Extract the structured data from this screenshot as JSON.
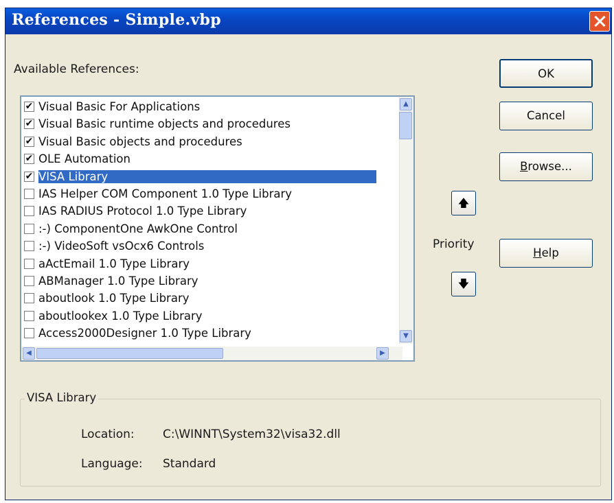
{
  "window": {
    "title": "References - Simple.vbp"
  },
  "available_label": "Available References:",
  "references": [
    {
      "label": "Visual Basic For Applications",
      "checked": true,
      "selected": false
    },
    {
      "label": "Visual Basic runtime objects and procedures",
      "checked": true,
      "selected": false
    },
    {
      "label": "Visual Basic objects and procedures",
      "checked": true,
      "selected": false
    },
    {
      "label": "OLE Automation",
      "checked": true,
      "selected": false
    },
    {
      "label": "VISA Library",
      "checked": true,
      "selected": true
    },
    {
      "label": "IAS Helper COM Component 1.0 Type Library",
      "checked": false,
      "selected": false
    },
    {
      "label": "IAS RADIUS Protocol 1.0 Type Library",
      "checked": false,
      "selected": false
    },
    {
      "label": ":-) ComponentOne AwkOne Control",
      "checked": false,
      "selected": false
    },
    {
      "label": ":-) VideoSoft vsOcx6 Controls",
      "checked": false,
      "selected": false
    },
    {
      "label": "aActEmail 1.0 Type Library",
      "checked": false,
      "selected": false
    },
    {
      "label": "ABManager 1.0 Type Library",
      "checked": false,
      "selected": false
    },
    {
      "label": "aboutlook 1.0 Type Library",
      "checked": false,
      "selected": false
    },
    {
      "label": "aboutlookex 1.0 Type Library",
      "checked": false,
      "selected": false
    },
    {
      "label": "Access2000Designer 1.0 Type Library",
      "checked": false,
      "selected": false
    }
  ],
  "buttons": {
    "ok": "OK",
    "cancel": "Cancel",
    "browse": "Browse...",
    "help": "Help"
  },
  "priority": {
    "label": "Priority",
    "up_icon": "arrow-up-icon",
    "down_icon": "arrow-down-icon"
  },
  "details": {
    "group_title": "VISA Library",
    "location_label": "Location:",
    "location_value": "C:\\WINNT\\System32\\visa32.dll",
    "language_label": "Language:",
    "language_value": "Standard"
  },
  "colors": {
    "title_bar": "#0a46c2",
    "selection": "#316ac5",
    "dialog_bg": "#ece9d8",
    "close": "#e4552b"
  }
}
